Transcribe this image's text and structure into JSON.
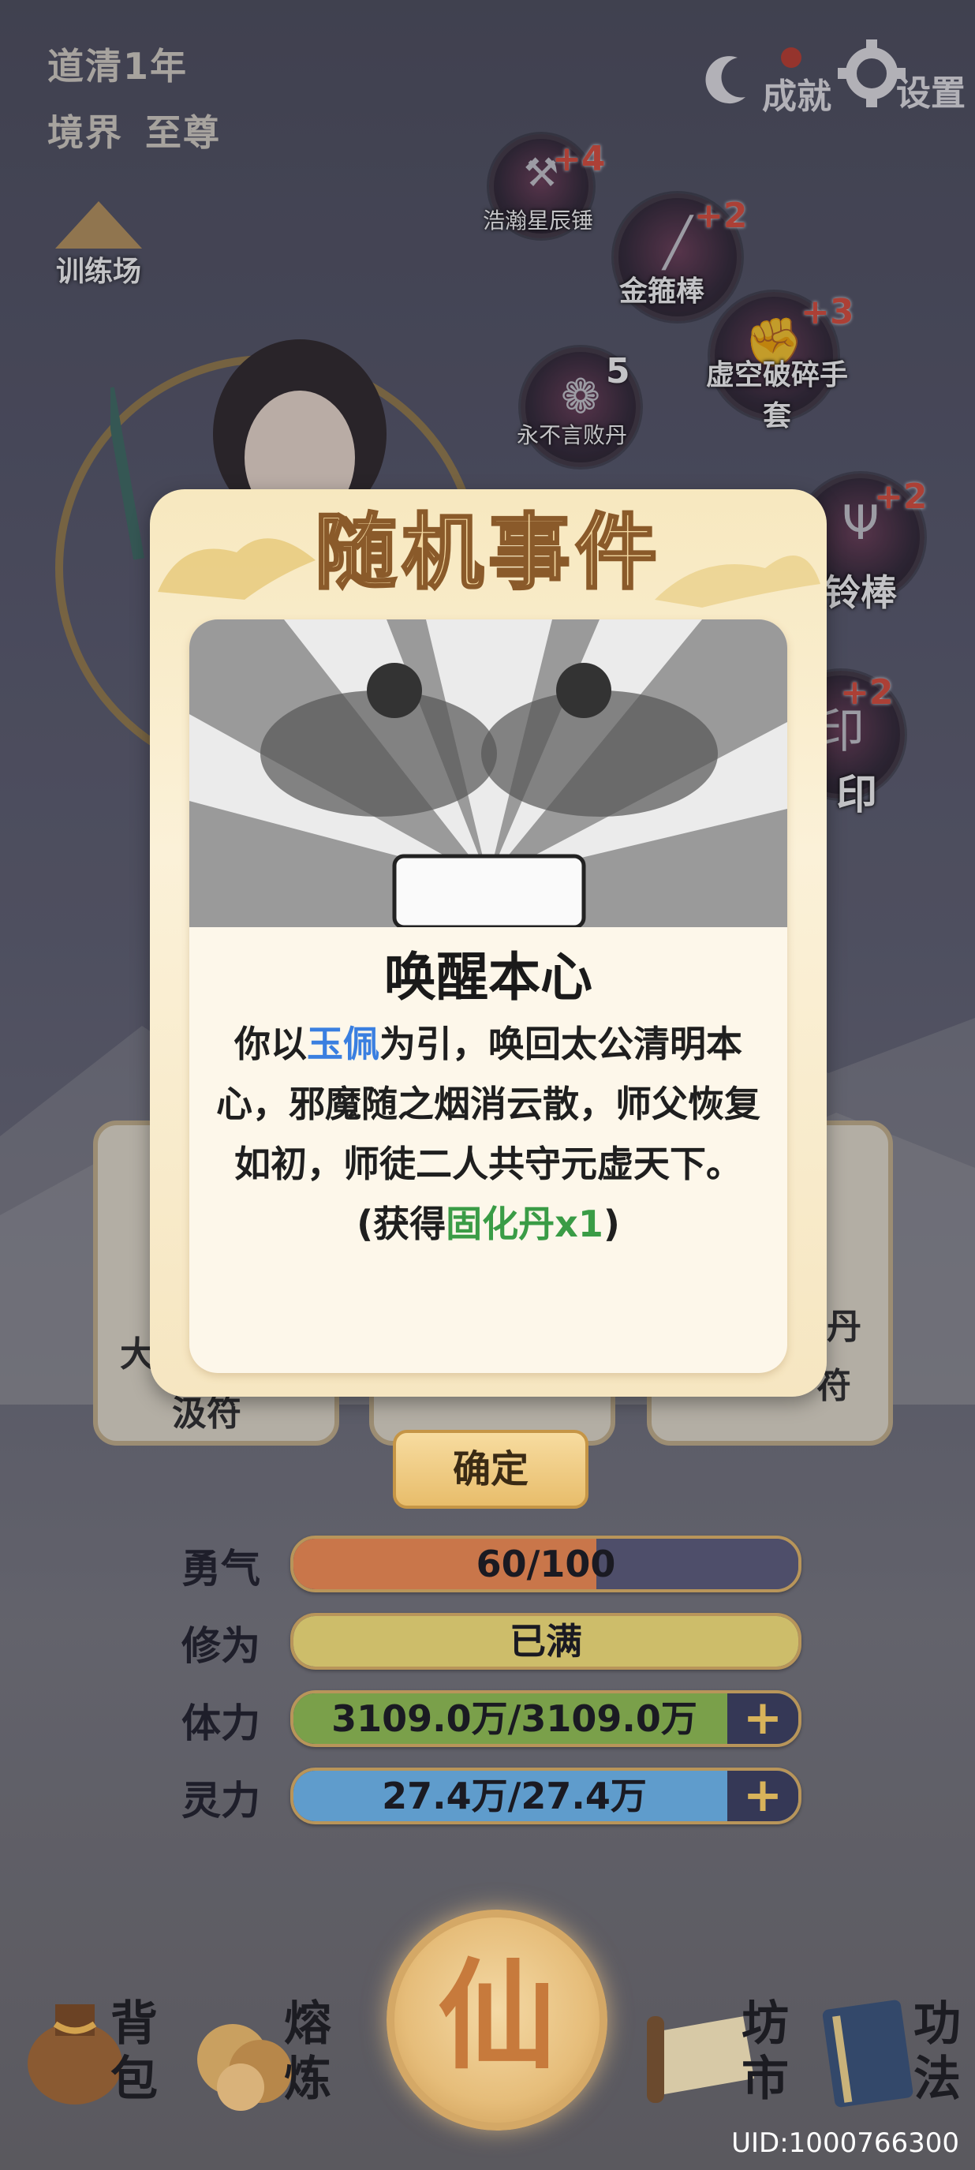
{
  "header": {
    "year_text": "道清1年",
    "realm_label": "境界",
    "realm_value": "至尊",
    "achievements_label": "成就",
    "settings_label": "设置"
  },
  "training_label": "训练场",
  "equipment": [
    {
      "name": "浩瀚星辰锤",
      "level": "+4",
      "icon": "hammer-icon"
    },
    {
      "name": "金箍棒",
      "level": "+2",
      "icon": "staff-icon"
    },
    {
      "name": "虚空破碎手套",
      "level": "+3",
      "icon": "gauntlet-icon"
    },
    {
      "name": "永不言败丹",
      "level": "5",
      "icon": "pill-chest-icon"
    },
    {
      "name": "铃棒",
      "level": "+2",
      "icon": "trident-icon"
    },
    {
      "name": "印",
      "level": "+2",
      "icon": "seal-icon"
    }
  ],
  "background_cards": {
    "left_label_1": "大",
    "left_label_2": "汲符",
    "right_label_1": "丹",
    "right_label_2": "符"
  },
  "event": {
    "header_title": "随机事件",
    "title": "唤醒本心",
    "text_part1": "你以",
    "text_highlight_item": "玉佩",
    "text_part2": "为引，唤回太公清明本心，邪魔随之烟消云散，师父恢复如初，师徒二人共守元虚天下。(获得",
    "text_reward": "固化丹x1",
    "text_part3": ")"
  },
  "confirm_label": "确定",
  "stats": [
    {
      "label": "勇气",
      "value": "60/100",
      "fill": 0.6,
      "color": "#c9764a"
    },
    {
      "label": "修为",
      "value": "已满",
      "fill": 1.0,
      "color": "#cdbd6a"
    },
    {
      "label": "体力",
      "value": "3109.0万/3109.0万",
      "fill": 1.0,
      "color": "#7aa04a"
    },
    {
      "label": "灵力",
      "value": "27.4万/27.4万",
      "fill": 1.0,
      "color": "#5f9ccc"
    }
  ],
  "nav": {
    "bag": "背包",
    "smelt": "熔炼",
    "center": "仙",
    "market": "坊市",
    "skills": "功法"
  },
  "uid": "UID:1000766300"
}
